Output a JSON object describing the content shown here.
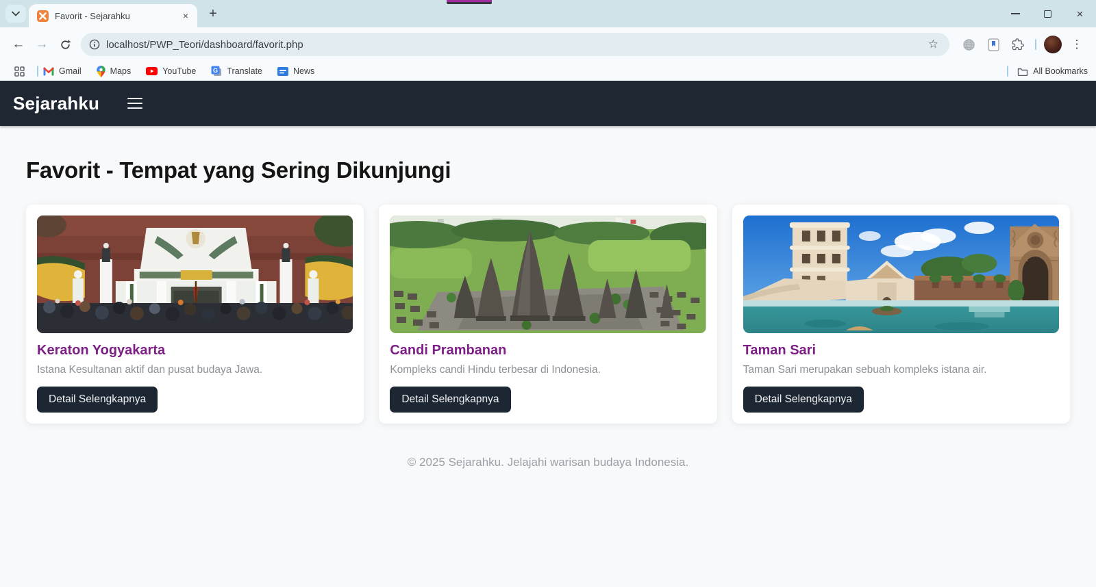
{
  "browser": {
    "tab_title": "Favorit - Sejarahku",
    "url": "localhost/PWP_Teori/dashboard/favorit.php",
    "bookmarks": [
      {
        "label": "Gmail"
      },
      {
        "label": "Maps"
      },
      {
        "label": "YouTube"
      },
      {
        "label": "Translate"
      },
      {
        "label": "News"
      }
    ],
    "all_bookmarks_label": "All Bookmarks",
    "icons": {
      "back": "←",
      "forward": "→",
      "star": "☆",
      "overflow": "⋮",
      "new_tab": "+",
      "tab_close": "×",
      "window_close": "×"
    }
  },
  "site": {
    "brand": "Sejarahku"
  },
  "page": {
    "title": "Favorit - Tempat yang Sering Dikunjungi",
    "cards": [
      {
        "title": "Keraton Yogyakarta",
        "description": "Istana Kesultanan aktif dan pusat budaya Jawa.",
        "button_label": "Detail Selengkapnya",
        "image": "keraton-yogyakarta-photo"
      },
      {
        "title": "Candi Prambanan",
        "description": "Kompleks candi Hindu terbesar di Indonesia.",
        "button_label": "Detail Selengkapnya",
        "image": "candi-prambanan-photo"
      },
      {
        "title": "Taman Sari",
        "description": "Taman Sari merupakan sebuah kompleks istana air.",
        "button_label": "Detail Selengkapnya",
        "image": "taman-sari-photo"
      }
    ],
    "footer": "© 2025 Sejarahku. Jelajahi warisan budaya Indonesia."
  },
  "colors": {
    "navbar_bg": "#1f2733",
    "button_bg": "#1d2733",
    "card_title": "#7d1f87",
    "page_bg": "#f7f9fa",
    "tabstrip_bg": "#cfe3e9",
    "omnibox_bg": "#e3edf1",
    "favicon_orange": "#f1823d"
  }
}
